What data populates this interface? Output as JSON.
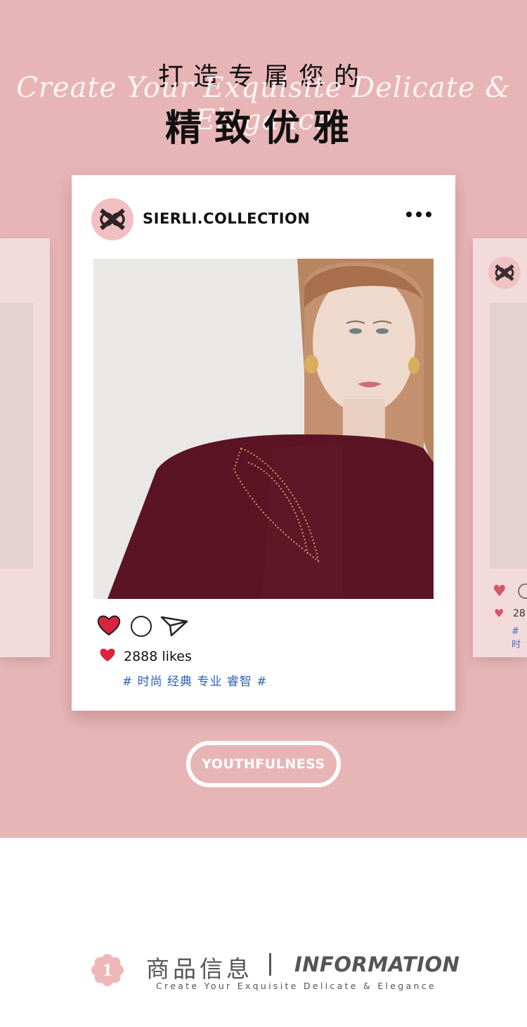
{
  "hero": {
    "title_top": "打造专属您的",
    "script_text": "Create Your Exquisite Delicate & Elegance",
    "title_main": "精致优雅",
    "background_color": "#e8b5b7"
  },
  "post": {
    "handle": "SIERLI.COLLECTION",
    "likes_text": "2888 likes",
    "tags": "# 时尚 经典 专业 睿智 #",
    "icons": [
      "logo-icon",
      "more-dots-icon",
      "heart-icon",
      "comment-icon",
      "share-icon"
    ]
  },
  "side_card": {
    "likes_partial": "28",
    "tags_partial": "# 时"
  },
  "button": {
    "label": "YOUTHFULNESS"
  },
  "info": {
    "number": "1",
    "title_cn": "商品信息",
    "title_en": "INFORMATION",
    "subtitle": "Create Your Exquisite Delicate & Elegance"
  },
  "colors": {
    "accent_pink": "#e8b5b7",
    "heart_red": "#d8243f",
    "tag_blue": "#2c62b8"
  }
}
